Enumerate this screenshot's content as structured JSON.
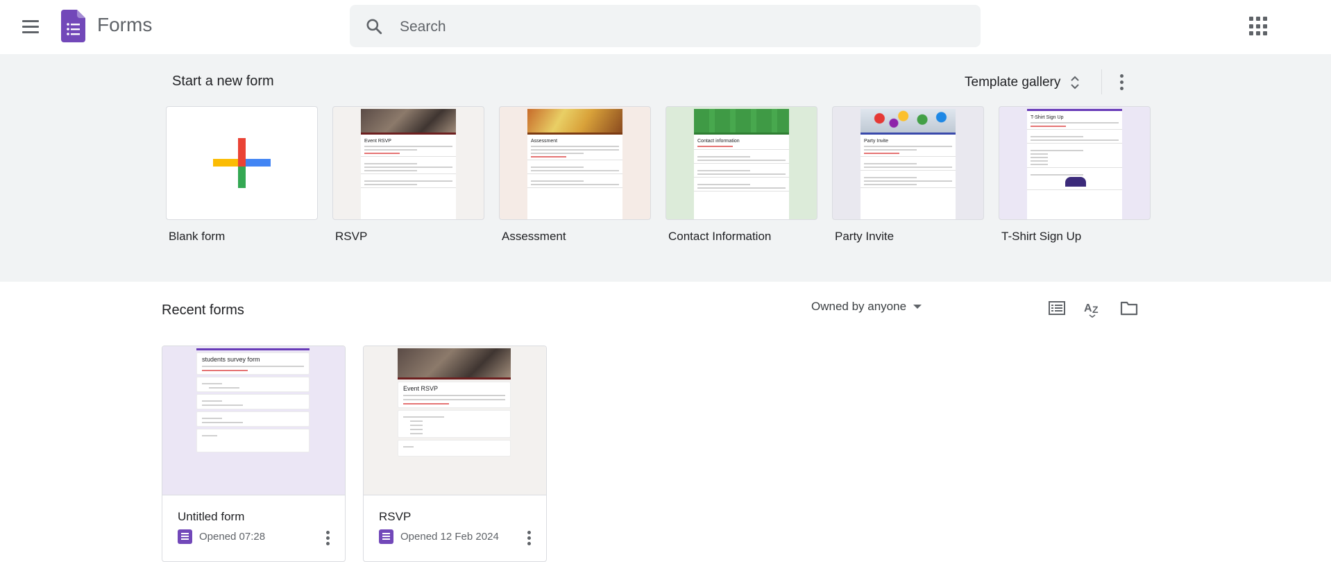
{
  "header": {
    "app_title": "Forms",
    "search_placeholder": "Search",
    "menu_icon": "hamburger-menu-icon",
    "apps_icon": "google-apps-grid-icon"
  },
  "start": {
    "title": "Start a new form",
    "template_gallery_label": "Template gallery",
    "templates": [
      {
        "label": "Blank form"
      },
      {
        "label": "RSVP",
        "preview_title": "Event RSVP"
      },
      {
        "label": "Assessment",
        "preview_title": "Assessment"
      },
      {
        "label": "Contact Information",
        "preview_title": "Contact information"
      },
      {
        "label": "Party Invite",
        "preview_title": "Party Invite"
      },
      {
        "label": "T-Shirt Sign Up",
        "preview_title": "T-Shirt Sign Up"
      }
    ]
  },
  "recent": {
    "title": "Recent forms",
    "owner_filter": "Owned by anyone",
    "docs": [
      {
        "name": "Untitled form",
        "meta": "Opened 07:28",
        "preview_title": "students survey form"
      },
      {
        "name": "RSVP",
        "meta": "Opened 12 Feb 2024",
        "preview_title": "Event RSVP"
      }
    ]
  },
  "colors": {
    "forms_purple": "#7248b9",
    "band_bg": "#f1f3f4",
    "plus_red": "#ea4335",
    "plus_blue": "#4285f4",
    "plus_green": "#34a853",
    "plus_yellow": "#fbbc04"
  }
}
